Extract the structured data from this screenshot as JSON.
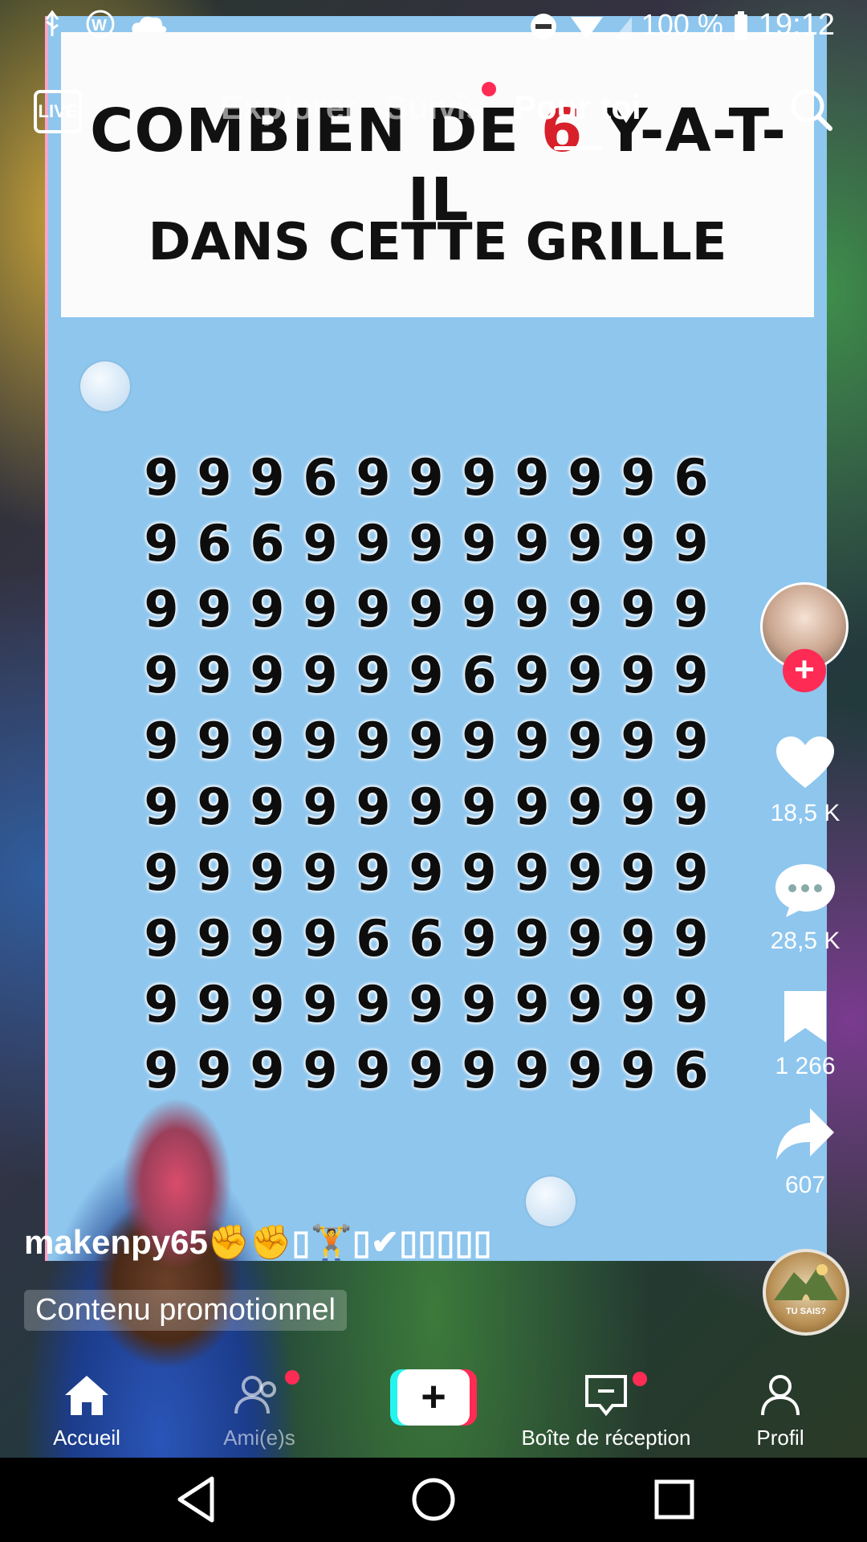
{
  "status_bar": {
    "battery": "100 %",
    "time": "19:12"
  },
  "top_nav": {
    "live_label": "LIVE",
    "tabs": [
      {
        "label": "Explorer"
      },
      {
        "label": "Suivis"
      },
      {
        "label": "Pour toi"
      }
    ]
  },
  "video": {
    "title_line1_before": "COMBIEN DE",
    "title_line1_emoji": "6",
    "title_line1_after": "Y-A-T-IL",
    "title_line2": "DANS CETTE GRILLE",
    "grid": [
      [
        "9",
        "9",
        "9",
        "6",
        "9",
        "9",
        "9",
        "9",
        "9",
        "9",
        "6"
      ],
      [
        "9",
        "6",
        "6",
        "9",
        "9",
        "9",
        "9",
        "9",
        "9",
        "9",
        "9"
      ],
      [
        "9",
        "9",
        "9",
        "9",
        "9",
        "9",
        "9",
        "9",
        "9",
        "9",
        "9"
      ],
      [
        "9",
        "9",
        "9",
        "9",
        "9",
        "9",
        "6",
        "9",
        "9",
        "9",
        "9"
      ],
      [
        "9",
        "9",
        "9",
        "9",
        "9",
        "9",
        "9",
        "9",
        "9",
        "9",
        "9"
      ],
      [
        "9",
        "9",
        "9",
        "9",
        "9",
        "9",
        "9",
        "9",
        "9",
        "9",
        "9"
      ],
      [
        "9",
        "9",
        "9",
        "9",
        "9",
        "9",
        "9",
        "9",
        "9",
        "9",
        "9"
      ],
      [
        "9",
        "9",
        "9",
        "9",
        "6",
        "6",
        "9",
        "9",
        "9",
        "9",
        "9"
      ],
      [
        "9",
        "9",
        "9",
        "9",
        "9",
        "9",
        "9",
        "9",
        "9",
        "9",
        "9"
      ],
      [
        "9",
        "9",
        "9",
        "9",
        "9",
        "9",
        "9",
        "9",
        "9",
        "9",
        "6"
      ]
    ]
  },
  "actions": {
    "likes": "18,5 K",
    "comments": "28,5 K",
    "saves": "1 266",
    "shares": "607",
    "music_disc_text": "TU SAIS?"
  },
  "creator": {
    "username": "makenpy65✊✊▯🏋▯✔▯▯▯▯▯",
    "promo_label": "Contenu promotionnel"
  },
  "bottom_tabs": {
    "home": "Accueil",
    "friends": "Ami(e)s",
    "inbox": "Boîte de réception",
    "profile": "Profil"
  },
  "colors": {
    "accent": "#fe2c55",
    "create_cyan": "#25f4ee",
    "puzzle_bg": "#8ec6ee"
  }
}
